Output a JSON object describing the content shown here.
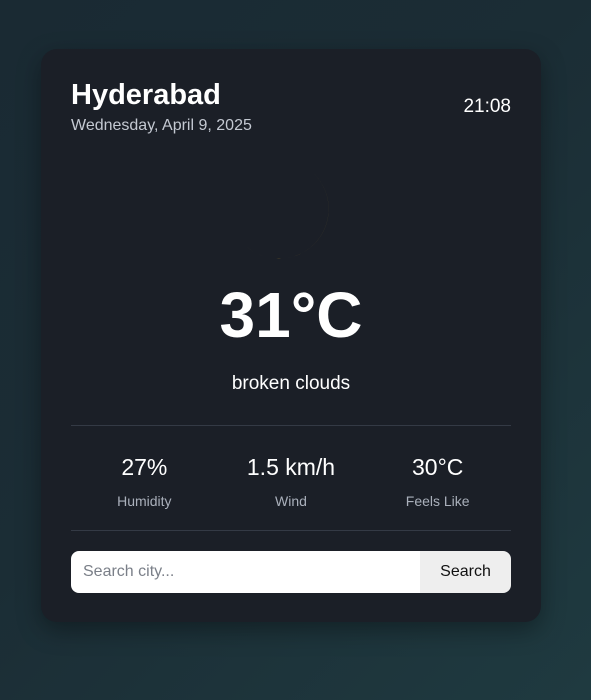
{
  "location": {
    "city": "Hyderabad",
    "date": "Wednesday, April 9, 2025",
    "time": "21:08"
  },
  "weather": {
    "icon": "moon-icon",
    "temperature": "31°C",
    "description": "broken clouds"
  },
  "stats": [
    {
      "value": "27%",
      "label": "Humidity"
    },
    {
      "value": "1.5 km/h",
      "label": "Wind"
    },
    {
      "value": "30°C",
      "label": "Feels Like"
    }
  ],
  "search": {
    "placeholder": "Search city...",
    "button_label": "Search"
  },
  "colors": {
    "card_background": "#1b1f27",
    "moon": "#f9c72a",
    "text": "#ffffff"
  }
}
